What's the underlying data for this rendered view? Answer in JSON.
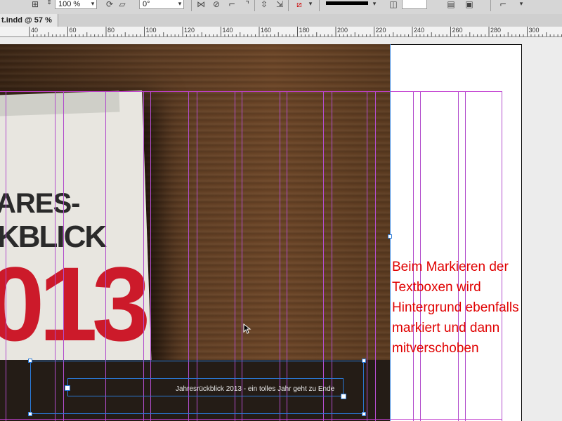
{
  "control_bar": {
    "scale_value": "100 %",
    "angle_value": "0°"
  },
  "document": {
    "tab_title": "t.indd @ 57 %"
  },
  "ruler": {
    "labels": [
      "40",
      "60",
      "80",
      "100",
      "120",
      "140",
      "160",
      "180",
      "200",
      "220",
      "240",
      "260",
      "280",
      "300"
    ]
  },
  "canvas": {
    "calendar_line1": "ARES-",
    "calendar_line2": "KBLICK",
    "calendar_year": "013",
    "caption_text": "Jahresrückblick 2013 - ein tolles Jahr geht zu Ende"
  },
  "annotation": {
    "lines": [
      "Beim Markieren der",
      "Textboxen wird",
      "Hintergrund ebenfalls",
      "markiert und dann",
      "mitverschoben"
    ]
  },
  "colors": {
    "annotation": "#e00000",
    "guide": "#b24dcc",
    "selection": "#2a79d6",
    "calendar_red": "#cc1a2a"
  }
}
